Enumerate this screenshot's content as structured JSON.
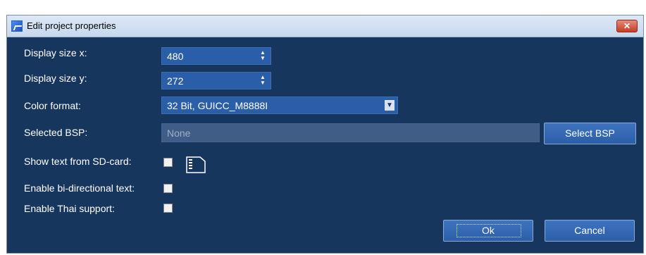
{
  "window": {
    "title": "Edit project properties",
    "close_glyph": "✕"
  },
  "fields": {
    "display_x": {
      "label": "Display size x:",
      "value": "480"
    },
    "display_y": {
      "label": "Display size y:",
      "value": "272"
    },
    "color_format": {
      "label": "Color format:",
      "value": "32 Bit, GUICC_M8888I"
    },
    "bsp": {
      "label": "Selected BSP:",
      "placeholder": "None",
      "button": "Select BSP"
    },
    "show_text_sd": {
      "label": "Show text from SD-card:",
      "checked": false,
      "icon": "sd-card-icon"
    },
    "bidi": {
      "label": "Enable bi-directional text:",
      "checked": false
    },
    "thai": {
      "label": "Enable Thai support:",
      "checked": false
    }
  },
  "buttons": {
    "ok": "Ok",
    "cancel": "Cancel"
  },
  "colors": {
    "background": "#17365e",
    "field": "#2b5ea8",
    "titlebar": "#dce8f6",
    "close": "#c63d24"
  }
}
